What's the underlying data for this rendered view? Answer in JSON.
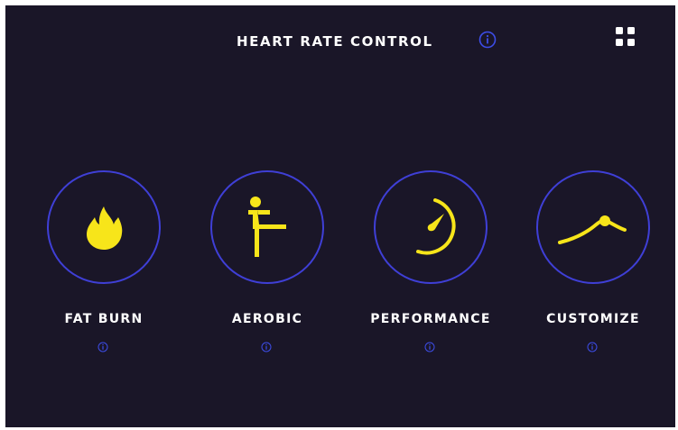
{
  "header": {
    "title": "HEART RATE CONTROL",
    "info_icon": "info-icon",
    "menu_icon": "grid-menu-icon"
  },
  "colors": {
    "background": "#1a1628",
    "accent_yellow": "#f7e51a",
    "circle_border": "#3f3fd6",
    "info_blue": "#3d4de8",
    "text": "#ffffff"
  },
  "modes": [
    {
      "label": "FAT BURN",
      "icon": "flame-icon",
      "info_icon": "info-icon"
    },
    {
      "label": "AEROBIC",
      "icon": "exercise-figure-icon",
      "info_icon": "info-icon"
    },
    {
      "label": "PERFORMANCE",
      "icon": "speedometer-icon",
      "info_icon": "info-icon"
    },
    {
      "label": "CUSTOMIZE",
      "icon": "custom-curve-icon",
      "info_icon": "info-icon"
    }
  ]
}
